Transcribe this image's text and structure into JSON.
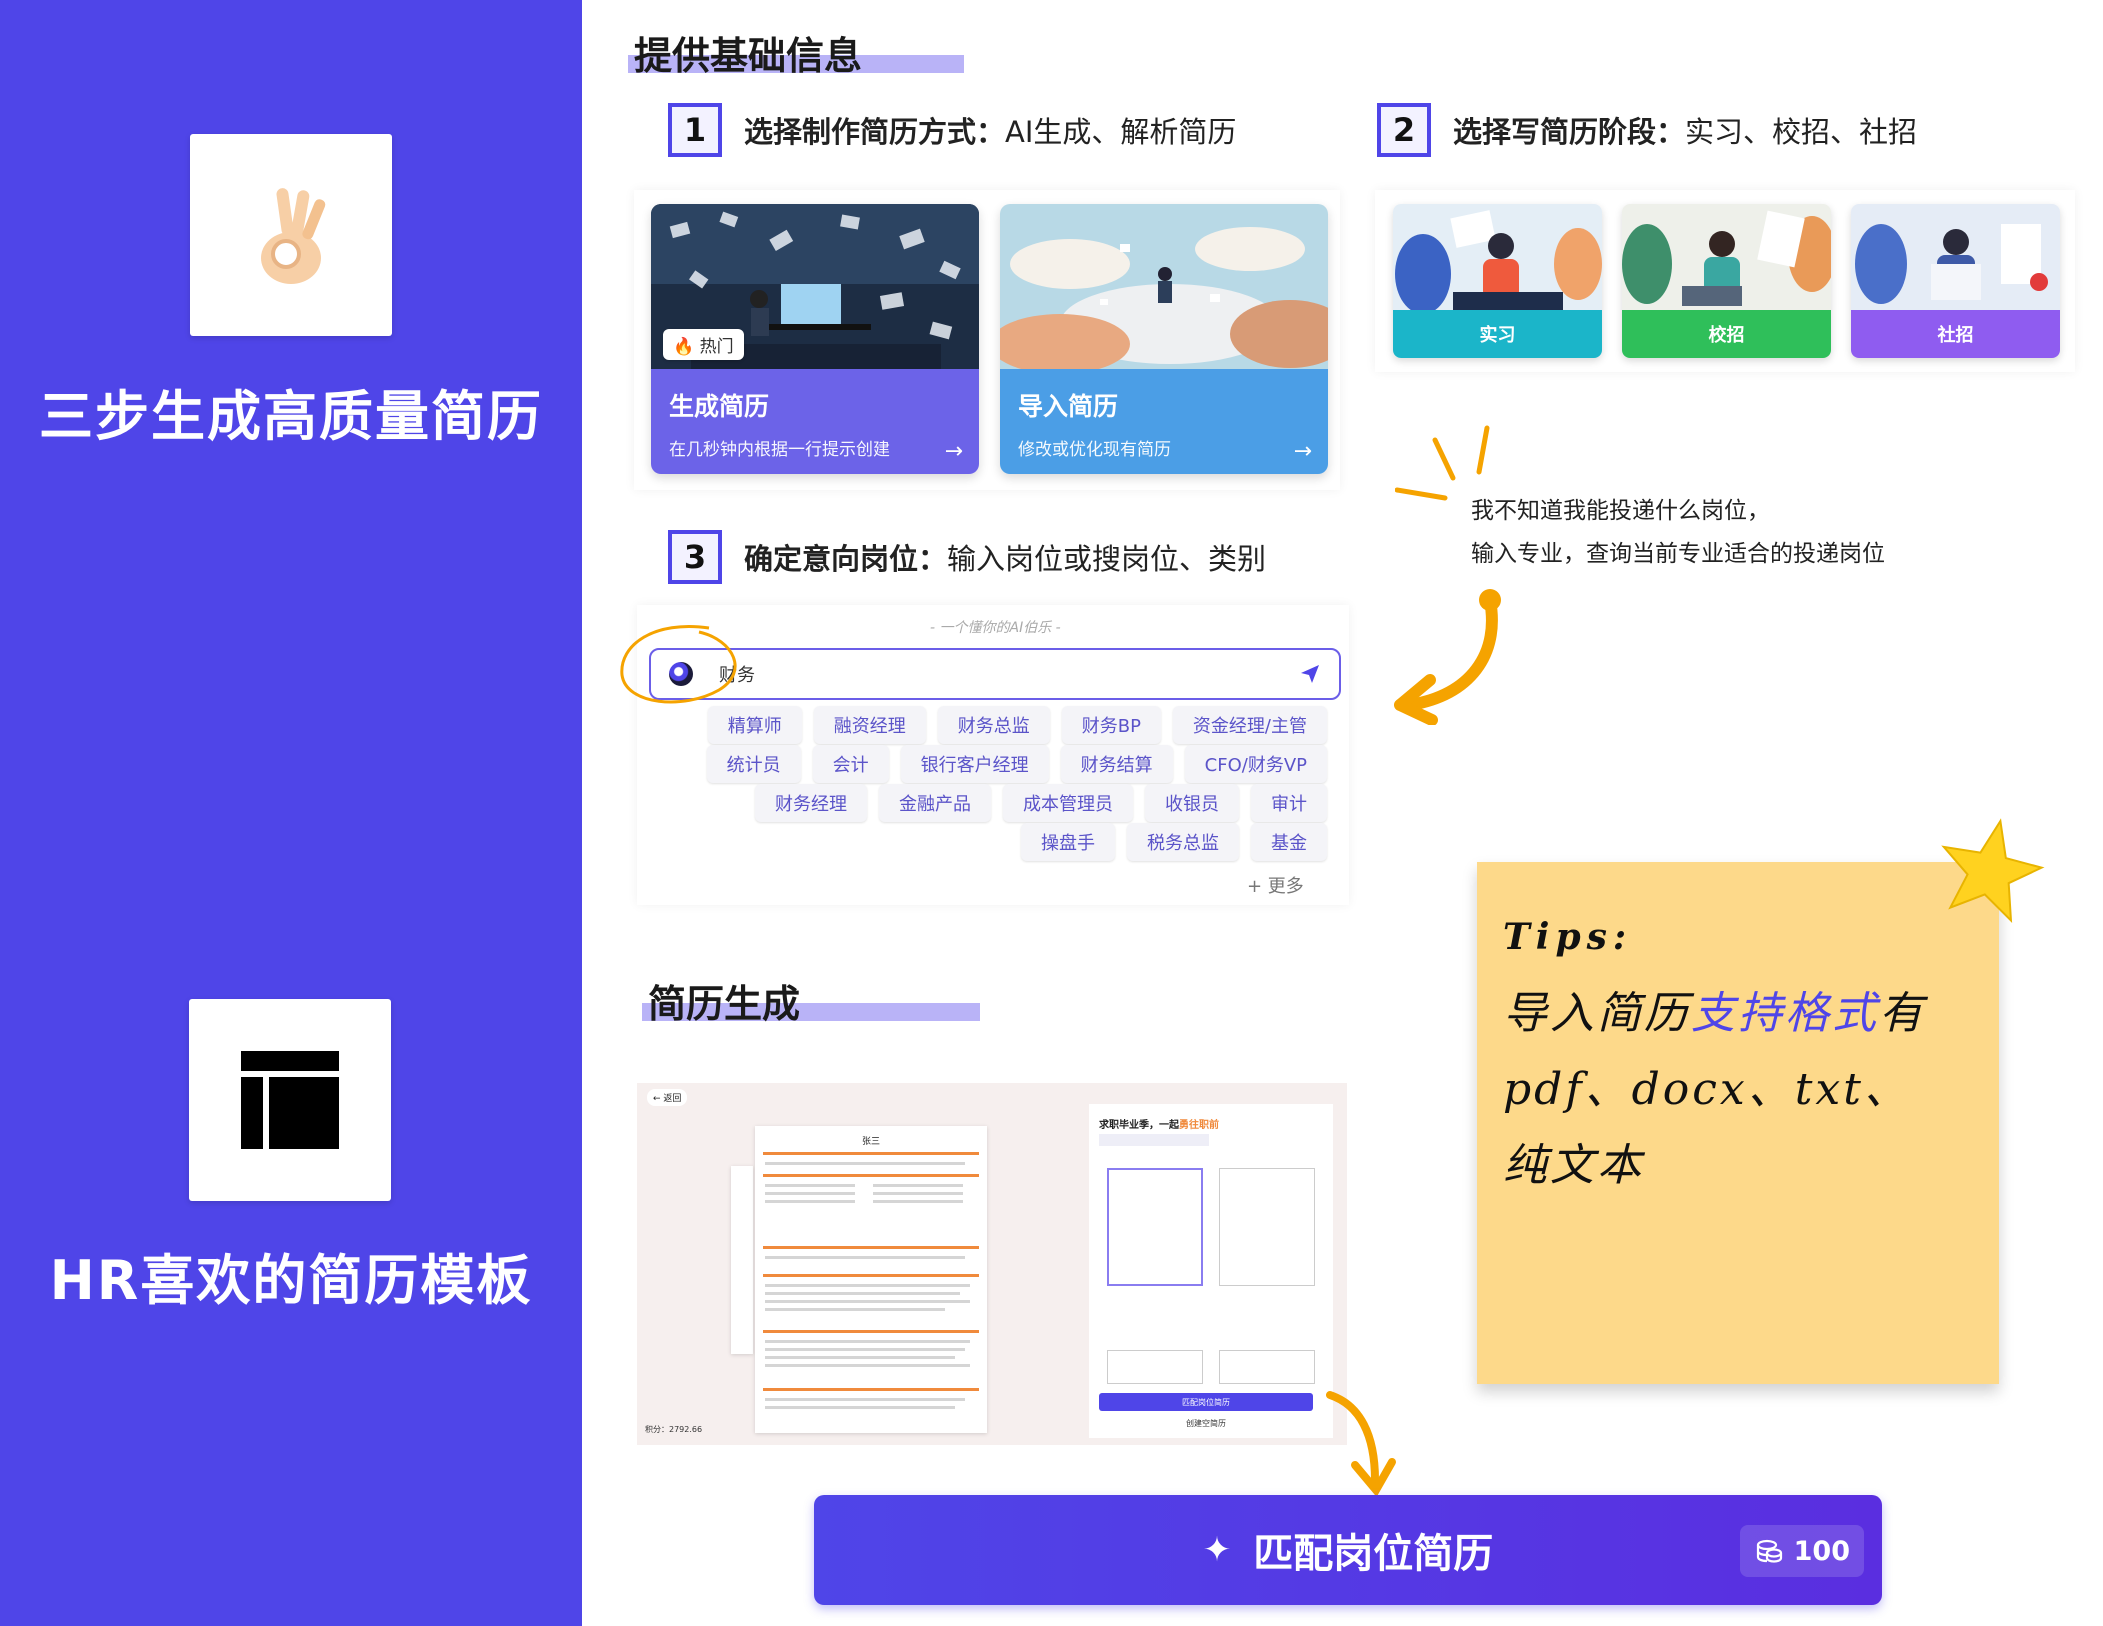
{
  "left": {
    "title1": "三步生成高质量简历",
    "title2": "HR喜欢的简历模板"
  },
  "section1": {
    "heading": "提供基础信息"
  },
  "section2": {
    "heading": "简历生成"
  },
  "step1": {
    "num": "1",
    "label": "选择制作简历方式：",
    "detail": "AI生成、解析简历"
  },
  "step2": {
    "num": "2",
    "label": "选择写简历阶段：",
    "detail": "实习、校招、社招"
  },
  "step3": {
    "num": "3",
    "label": "确定意向岗位：",
    "detail": "输入岗位或搜岗位、类别"
  },
  "cards": [
    {
      "title": "生成简历",
      "subtitle": "在几秒钟内根据一行提示创建",
      "badge": "热门",
      "arrow": "→",
      "color": "#6c63e8"
    },
    {
      "title": "导入简历",
      "subtitle": "修改或优化现有简历",
      "arrow": "→",
      "color": "#4b9ee6"
    }
  ],
  "stages": [
    {
      "label": "实习",
      "color": "#1bb5c9"
    },
    {
      "label": "校招",
      "color": "#2fbf5a"
    },
    {
      "label": "社招",
      "color": "#8f5cf0"
    }
  ],
  "hint": {
    "line1": "我不知道我能投递什么岗位，",
    "line2": "输入专业，查询当前专业适合的投递岗位"
  },
  "search": {
    "caption": "- 一个懂你的AI伯乐 -",
    "value": "财务"
  },
  "chips": [
    [
      "精算师",
      "融资经理",
      "财务总监",
      "财务BP",
      "资金经理/主管"
    ],
    [
      "统计员",
      "会计",
      "银行客户经理",
      "财务结算",
      "CFO/财务VP"
    ],
    [
      "财务经理",
      "金融产品",
      "成本管理员",
      "收银员",
      "审计"
    ],
    [
      "操盘手",
      "税务总监",
      "基金"
    ]
  ],
  "more": "+ 更多",
  "tips": {
    "title": "Tips:",
    "line1_a": "导入简历",
    "line1_b": "支持格式",
    "line1_c": "有",
    "line2": "pdf、docx、txt、",
    "line3": "纯文本"
  },
  "preview": {
    "back": "← 返回",
    "resume_name": "张三",
    "panel_title": "求职毕业季，一起",
    "panel_title_hl": "勇往职前",
    "match_btn": "匹配岗位简历",
    "create_btn": "创建空简历",
    "score": "积分：2792.66"
  },
  "cta": {
    "label": "匹配岗位简历",
    "count": "100"
  },
  "colors": {
    "accent": "#4f45e8",
    "sticky": "#fdd98a",
    "arrow": "#f5a300"
  }
}
